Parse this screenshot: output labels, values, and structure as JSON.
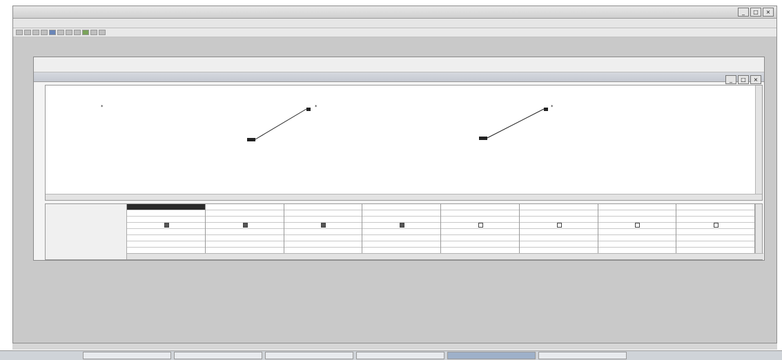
{
  "app": {
    "title": "",
    "menu": [
      "",
      "",
      "",
      "",
      "",
      "",
      "",
      ""
    ]
  },
  "designer": {
    "toolbar": [
      "",
      "",
      ""
    ],
    "title": "",
    "tables": [
      {
        "caption": "",
        "fields": [
          {
            "name": "",
            "key": true
          },
          {
            "name": "",
            "key": false
          },
          {
            "name": "",
            "key": false
          },
          {
            "name": "",
            "key": false
          },
          {
            "name": "",
            "key": false
          },
          {
            "name": "",
            "key": false
          },
          {
            "name": "",
            "key": false
          }
        ]
      },
      {
        "caption": "",
        "fields": [
          {
            "name": "",
            "key": true
          },
          {
            "name": "",
            "key": false
          },
          {
            "name": "",
            "key": false
          },
          {
            "name": "",
            "key": false
          },
          {
            "name": "",
            "key": false
          }
        ]
      },
      {
        "caption": "",
        "fields": [
          {
            "name": "",
            "key": true
          },
          {
            "name": "",
            "key": false
          },
          {
            "name": "",
            "key": false
          },
          {
            "name": "",
            "key": false
          },
          {
            "name": "",
            "key": false
          },
          {
            "name": "",
            "key": false
          },
          {
            "name": "",
            "key": false
          },
          {
            "name": "",
            "key": false
          }
        ]
      }
    ],
    "grid": {
      "row_labels": [
        "",
        "",
        "",
        "",
        "",
        ""
      ],
      "columns": [
        {
          "field": "",
          "table": "",
          "show": true
        },
        {
          "field": "",
          "table": "",
          "show": true
        },
        {
          "field": "",
          "table": "",
          "show": true
        },
        {
          "field": "",
          "table": "",
          "show": true
        },
        {
          "field": "",
          "table": "",
          "show": false
        },
        {
          "field": "",
          "table": "",
          "show": false
        },
        {
          "field": "",
          "table": "",
          "show": false
        },
        {
          "field": "",
          "table": "",
          "show": false
        }
      ]
    }
  },
  "status": "",
  "taskbar": {
    "items": [
      "",
      "",
      "",
      "",
      "",
      ""
    ],
    "clock": ""
  }
}
